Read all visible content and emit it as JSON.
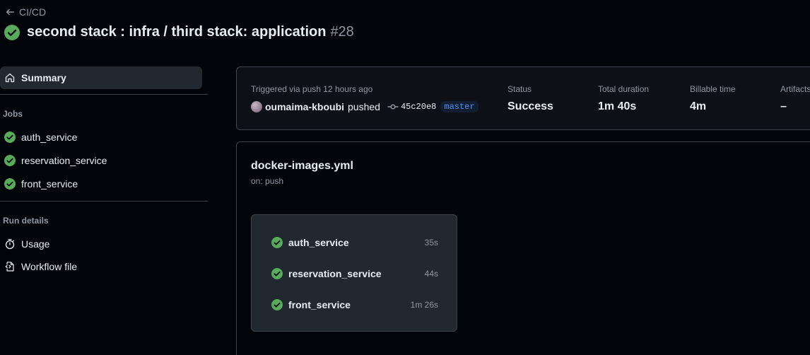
{
  "header": {
    "back_label": "CI/CD",
    "title": "second stack : infra / third stack: application",
    "run_number": "#28"
  },
  "sidebar": {
    "summary_label": "Summary",
    "jobs_heading": "Jobs",
    "jobs": [
      {
        "label": "auth_service",
        "status": "success"
      },
      {
        "label": "reservation_service",
        "status": "success"
      },
      {
        "label": "front_service",
        "status": "success"
      }
    ],
    "run_details_heading": "Run details",
    "run_details": [
      {
        "label": "Usage",
        "icon": "stopwatch-icon"
      },
      {
        "label": "Workflow file",
        "icon": "file-code-icon"
      }
    ]
  },
  "summary": {
    "trigger_text": "Triggered via push 12 hours ago",
    "user": "oumaima-kboubi",
    "action": "pushed",
    "commit_sha": "45c20e8",
    "branch": "master",
    "status_label": "Status",
    "status_value": "Success",
    "duration_label": "Total duration",
    "duration_value": "1m 40s",
    "billable_label": "Billable time",
    "billable_value": "4m",
    "artifacts_label": "Artifacts",
    "artifacts_value": "–"
  },
  "workflow": {
    "file_name": "docker-images.yml",
    "trigger": "on: push",
    "jobs": [
      {
        "name": "auth_service",
        "duration": "35s"
      },
      {
        "name": "reservation_service",
        "duration": "44s"
      },
      {
        "name": "front_service",
        "duration": "1m 26s"
      }
    ]
  },
  "colors": {
    "success": "#57ab5a",
    "background": "#010409",
    "accent": "#4493f8"
  }
}
